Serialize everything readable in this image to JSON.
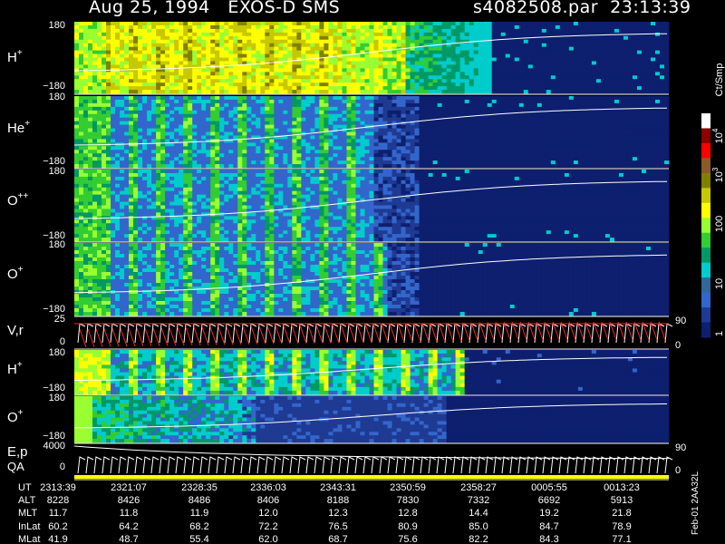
{
  "header": {
    "title_left": "Aug 25, 1994   EXOS-D SMS",
    "title_right": "s4082508.par  23:13:39"
  },
  "colorbar": {
    "unit_label": "Ct/Smp",
    "tick_labels": [
      "10",
      "10",
      "100",
      "10",
      "1"
    ],
    "tick_exponents": [
      "4",
      "3",
      "",
      "",
      ""
    ],
    "colors": [
      "#ffffff",
      "#8b0000",
      "#ff0000",
      "#8b5a2b",
      "#808000",
      "#c8c800",
      "#ffff00",
      "#99ff33",
      "#33cc33",
      "#009966",
      "#00cccc",
      "#336699",
      "#3366cc",
      "#1f3a93",
      "#0d1f6e"
    ]
  },
  "panels": [
    {
      "label": "H",
      "sup": "+",
      "ymax": "180",
      "ymin": "−180"
    },
    {
      "label": "He",
      "sup": "+",
      "ymax": "180",
      "ymin": "−180"
    },
    {
      "label": "O",
      "sup": "++",
      "ymax": "180",
      "ymin": "−180"
    },
    {
      "label": "O",
      "sup": "+",
      "ymax": "180",
      "ymin": "−180"
    },
    {
      "label": "V,r",
      "sup": "",
      "ymax": "25",
      "ymin": "0",
      "right_max": "90",
      "right_min": "0"
    },
    {
      "label": "H",
      "sup": "+",
      "ymax": "180",
      "ymin": "−180"
    },
    {
      "label": "O",
      "sup": "+",
      "ymax": "180",
      "ymin": "−180"
    },
    {
      "label": "E,p",
      "label2": "QA",
      "ymax": "4000",
      "ymin": "0",
      "right_max": "90",
      "right_min": "0"
    }
  ],
  "footer": {
    "rows": [
      {
        "name": "UT",
        "values": [
          "2313:39",
          "2321:07",
          "2328:35",
          "2336:03",
          "2343:31",
          "2350:59",
          "2358:27",
          "0005:55",
          "0013:23"
        ]
      },
      {
        "name": "ALT",
        "values": [
          "8228",
          "8426",
          "8486",
          "8406",
          "8188",
          "7830",
          "7332",
          "6692",
          "5913"
        ]
      },
      {
        "name": "MLT",
        "values": [
          "11.7",
          "11.8",
          "11.9",
          "12.0",
          "12.3",
          "12.8",
          "14.4",
          "19.2",
          "21.8"
        ]
      },
      {
        "name": "InLat",
        "values": [
          "60.2",
          "64.2",
          "68.2",
          "72.2",
          "76.5",
          "80.9",
          "85.0",
          "84.7",
          "78.9"
        ]
      },
      {
        "name": "MLat",
        "values": [
          "41.9",
          "48.7",
          "55.4",
          "62.0",
          "68.7",
          "75.6",
          "82.2",
          "84.3",
          "77.1"
        ]
      }
    ],
    "side_label": "Feb-01 2AA32L"
  },
  "chart_data": {
    "type": "heatmap",
    "title": "Aug 25, 1994   EXOS-D SMS",
    "x_tick_labels": [
      "2313:39",
      "2321:07",
      "2328:35",
      "2336:03",
      "2343:31",
      "2350:59",
      "2358:27",
      "0005:55",
      "0013:23"
    ],
    "series": [
      {
        "name": "H+",
        "ylim": [
          -180,
          180
        ]
      },
      {
        "name": "He+",
        "ylim": [
          -180,
          180
        ]
      },
      {
        "name": "O++",
        "ylim": [
          -180,
          180
        ]
      },
      {
        "name": "O+",
        "ylim": [
          -180,
          180
        ]
      },
      {
        "name": "V,r",
        "ylim": [
          0,
          25
        ],
        "right_ylim": [
          0,
          90
        ]
      },
      {
        "name": "H+",
        "ylim": [
          -180,
          180
        ]
      },
      {
        "name": "O+",
        "ylim": [
          -180,
          180
        ]
      },
      {
        "name": "E,p",
        "ylim": [
          0,
          4000
        ],
        "right_ylim": [
          0,
          90
        ]
      }
    ],
    "colorbar": {
      "scale": "log",
      "ticks": [
        1,
        10,
        100,
        1000,
        10000
      ],
      "unit": "Ct/Smp"
    }
  }
}
